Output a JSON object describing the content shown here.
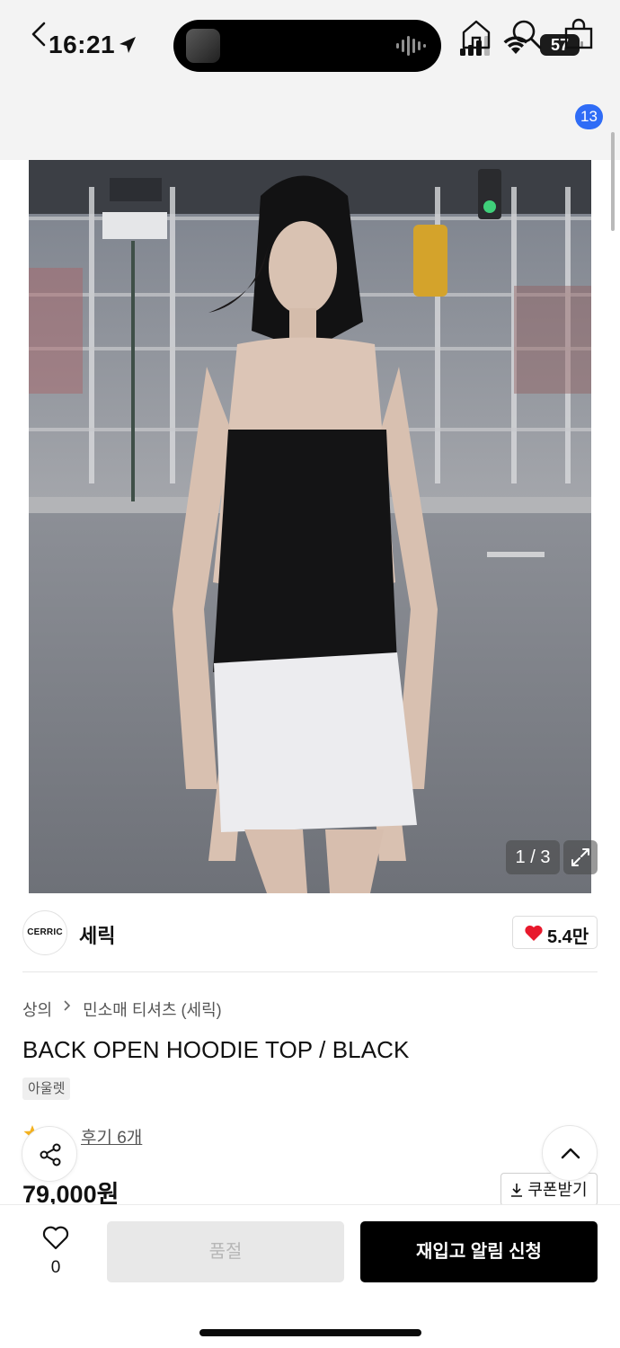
{
  "status_bar": {
    "time": "16:21",
    "battery": "57"
  },
  "header": {
    "cart_count": "13"
  },
  "gallery": {
    "counter": "1 / 3"
  },
  "brand": {
    "logo_text": "CERRIC",
    "name": "세릭",
    "likes": "5.4만"
  },
  "product": {
    "breadcrumb": [
      "상의",
      "민소매 티셔츠 (세릭)"
    ],
    "title": "BACK OPEN HOODIE TOP / BLACK",
    "tag": "아울렛",
    "review_link": "후기 6개",
    "price": "79,000원",
    "coupon_label": "쿠폰받기"
  },
  "bottom_bar": {
    "wish_count": "0",
    "soldout_label": "품절",
    "restock_label": "재입고 알림 신청"
  },
  "colors": {
    "badge": "#2f6cf6",
    "heart": "#e8192c",
    "primary_button": "#000000",
    "disabled_button": "#e8e8e8"
  },
  "icons": [
    "location-arrow-icon",
    "signal-icon",
    "wifi-icon",
    "back-icon",
    "home-icon",
    "search-icon",
    "cart-icon",
    "expand-icon",
    "heart-icon",
    "chevron-right-icon",
    "star-icon",
    "share-icon",
    "chevron-up-icon",
    "download-icon",
    "heart-outline-icon"
  ]
}
